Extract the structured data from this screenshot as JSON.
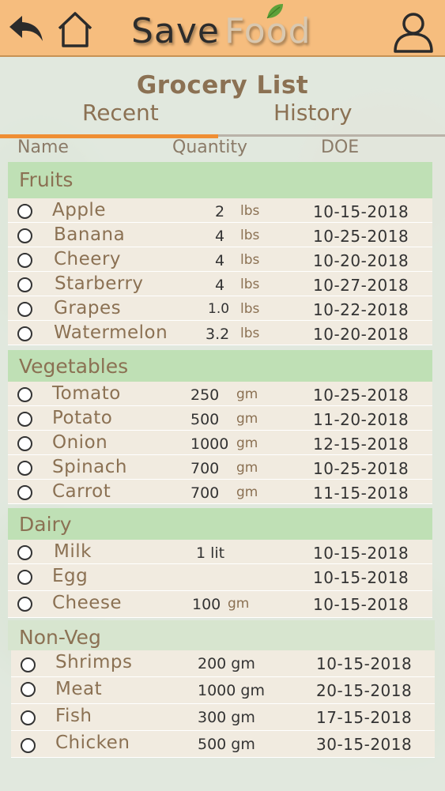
{
  "app": {
    "title_part1": "Save",
    "title_part2": "Food",
    "icons": {
      "back": "back-arrow-icon",
      "home": "home-icon",
      "user": "user-profile-icon",
      "leaf": "leaf-icon"
    },
    "colors": {
      "header": "#f6bd7e",
      "accent_tab": "#ef8e33",
      "section": "#bfe0b5",
      "text_brown": "#8b7153"
    }
  },
  "page": {
    "title": "Grocery List",
    "tabs": [
      {
        "label": "Recent",
        "active": true
      },
      {
        "label": "History",
        "active": false
      }
    ],
    "columns": {
      "name": "Name",
      "quantity": "Quantity",
      "doe": "DOE"
    }
  },
  "sections": [
    {
      "label": "Fruits",
      "items": [
        {
          "name": "Apple",
          "qty": "2",
          "unit": "lbs",
          "doe": "10-15-2018"
        },
        {
          "name": "Banana",
          "qty": "4",
          "unit": "lbs",
          "doe": "10-25-2018"
        },
        {
          "name": "Cheery",
          "qty": "4",
          "unit": "lbs",
          "doe": "10-20-2018"
        },
        {
          "name": "Starberry",
          "qty": "4",
          "unit": "lbs",
          "doe": "10-27-2018"
        },
        {
          "name": "Grapes",
          "qty": "1.0",
          "unit": "lbs",
          "doe": "10-22-2018"
        },
        {
          "name": "Watermelon",
          "qty": "3.2",
          "unit": "lbs",
          "doe": "10-20-2018"
        }
      ]
    },
    {
      "label": "Vegetables",
      "items": [
        {
          "name": "Tomato",
          "qty": "250",
          "unit": "gm",
          "doe": "10-25-2018"
        },
        {
          "name": "Potato",
          "qty": "500",
          "unit": "gm",
          "doe": "11-20-2018"
        },
        {
          "name": "Onion",
          "qty": "1000",
          "unit": "gm",
          "doe": "12-15-2018"
        },
        {
          "name": "Spinach",
          "qty": "700",
          "unit": "gm",
          "doe": "10-25-2018"
        },
        {
          "name": "Carrot",
          "qty": "700",
          "unit": "gm",
          "doe": "11-15-2018"
        }
      ]
    },
    {
      "label": "Dairy",
      "items": [
        {
          "name": "Milk",
          "qty": "1 lit",
          "unit": "",
          "doe": "10-15-2018"
        },
        {
          "name": "Egg",
          "qty": "",
          "unit": "",
          "doe": "10-15-2018"
        },
        {
          "name": "Cheese",
          "qty": "100",
          "unit": "gm",
          "doe": "10-15-2018"
        }
      ]
    },
    {
      "label": "Non-Veg",
      "items": [
        {
          "name": "Shrimps",
          "qty": "200 gm",
          "unit": "",
          "doe": "10-15-2018"
        },
        {
          "name": "Meat",
          "qty": "1000 gm",
          "unit": "",
          "doe": "20-15-2018"
        },
        {
          "name": "Fish",
          "qty": "300 gm",
          "unit": "",
          "doe": "17-15-2018"
        },
        {
          "name": "Chicken",
          "qty": "500 gm",
          "unit": "",
          "doe": "30-15-2018"
        }
      ]
    }
  ]
}
